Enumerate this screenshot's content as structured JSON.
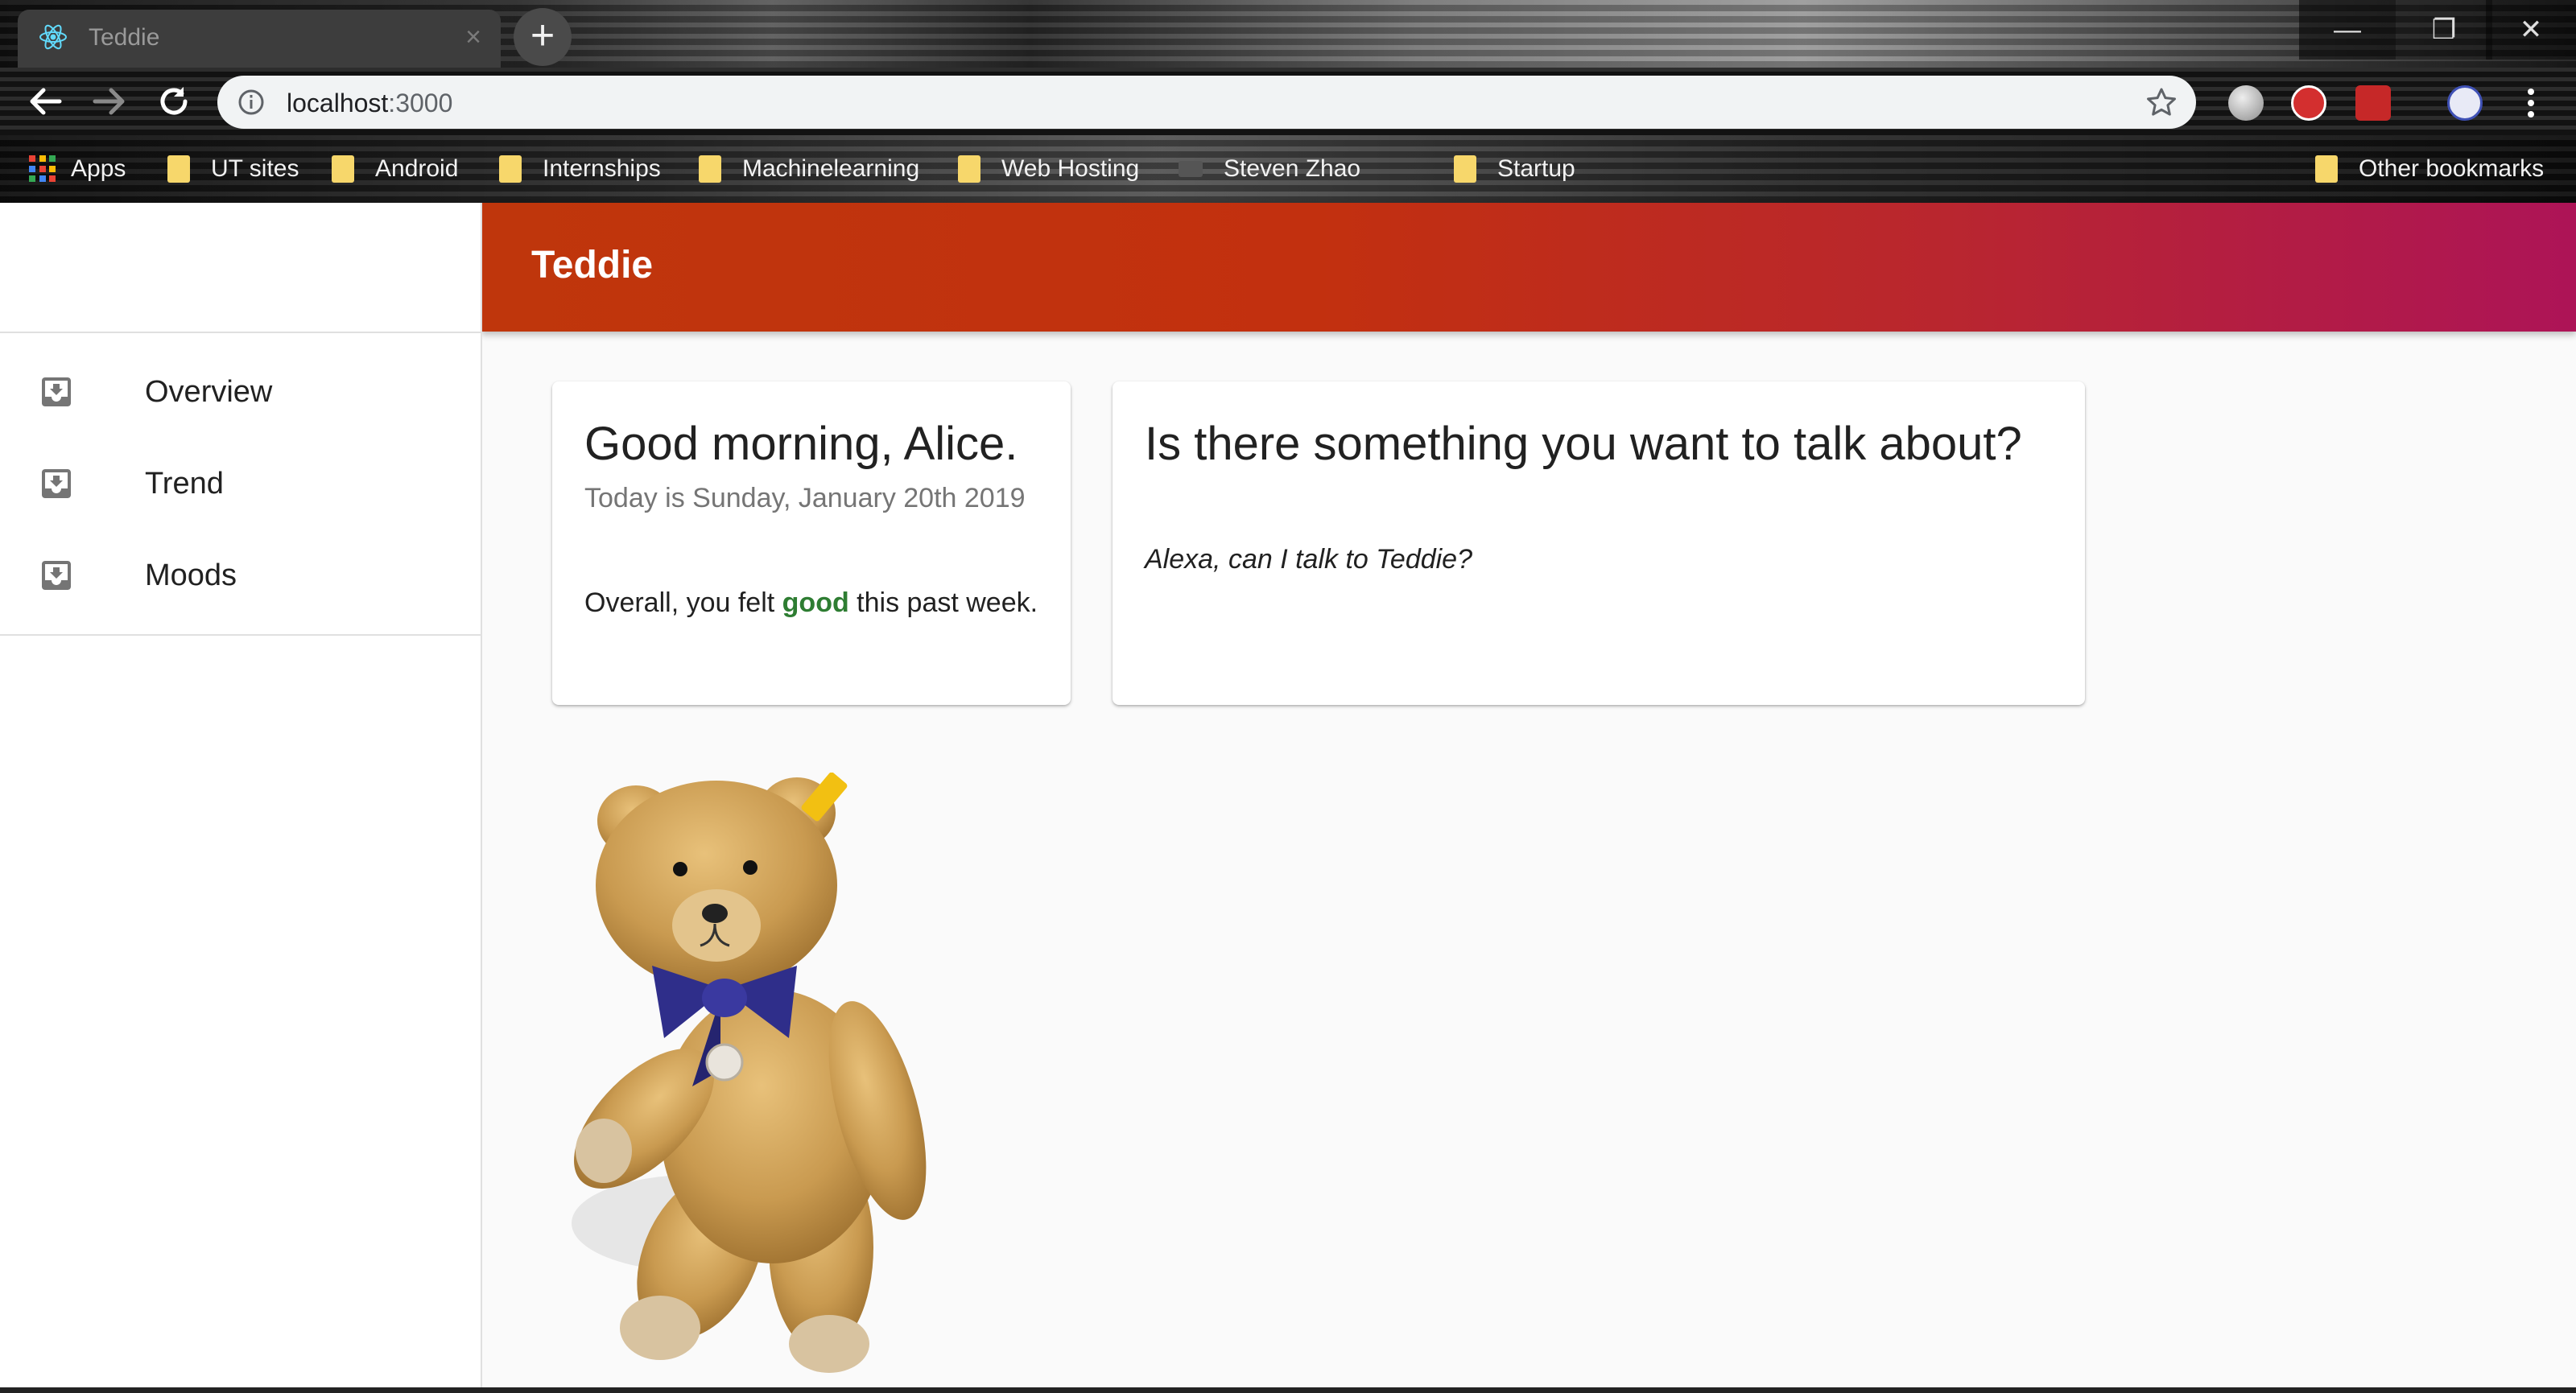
{
  "browser": {
    "tab_title": "Teddie",
    "url_host": "localhost",
    "url_port": ":3000",
    "bookmarks": [
      {
        "label": "Apps",
        "icon": "apps-grid-icon"
      },
      {
        "label": "UT sites",
        "icon": "folder-icon"
      },
      {
        "label": "Android",
        "icon": "folder-icon"
      },
      {
        "label": "Internships",
        "icon": "folder-icon"
      },
      {
        "label": "Machinelearning",
        "icon": "folder-icon"
      },
      {
        "label": "Web Hosting",
        "icon": "folder-icon"
      },
      {
        "label": "Steven Zhao",
        "icon": "page-icon"
      },
      {
        "label": "Startup",
        "icon": "folder-icon"
      }
    ],
    "other_bookmarks": "Other bookmarks"
  },
  "app": {
    "title": "Teddie",
    "header_gradient": [
      "#bf360c",
      "#ad1457"
    ]
  },
  "sidebar": {
    "items": [
      {
        "label": "Overview",
        "icon": "move-to-inbox-icon"
      },
      {
        "label": "Trend",
        "icon": "move-to-inbox-icon"
      },
      {
        "label": "Moods",
        "icon": "move-to-inbox-icon"
      }
    ]
  },
  "greeting_card": {
    "title": "Good morning, Alice.",
    "date_line": "Today is Sunday, January 20th 2019",
    "summary_prefix": "Overall, you felt ",
    "summary_mood": "good",
    "summary_suffix": " this past week.",
    "mood_color": "#2e7d32"
  },
  "talk_card": {
    "title": "Is there something you want to talk about?",
    "prompt": "Alexa, can I talk to Teddie?"
  }
}
